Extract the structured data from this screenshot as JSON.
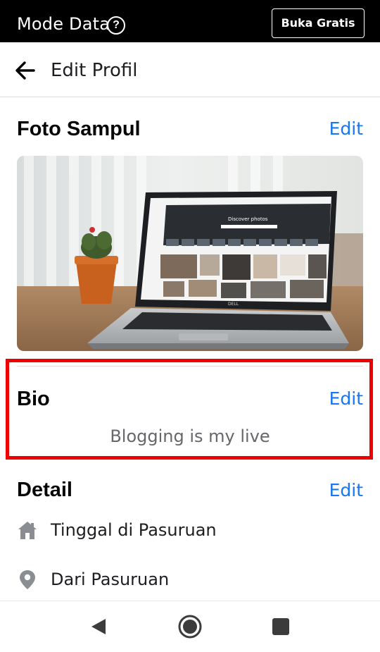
{
  "status_bar": {
    "mode_title": "Mode Data",
    "help_icon": "?",
    "free_button": "Buka Gratis"
  },
  "header": {
    "title": "Edit Profil"
  },
  "cover_photo": {
    "title": "Foto Sampul",
    "edit_label": "Edit",
    "laptop_screen_text": "Discover photos",
    "laptop_brand": "DELL"
  },
  "bio": {
    "title": "Bio",
    "edit_label": "Edit",
    "text": "Blogging is my live"
  },
  "details": {
    "title": "Detail",
    "edit_label": "Edit",
    "items": [
      {
        "icon": "home-icon",
        "text": "Tinggal di Pasuruan"
      },
      {
        "icon": "location-pin-icon",
        "text": "Dari Pasuruan"
      }
    ]
  },
  "colors": {
    "accent": "#1877f2",
    "highlight": "#ee0000",
    "topbar": "#000000",
    "icon_gray": "#8a8d91"
  },
  "nav": {
    "buttons": [
      "back-nav-icon",
      "home-nav-icon",
      "recents-nav-icon"
    ]
  }
}
